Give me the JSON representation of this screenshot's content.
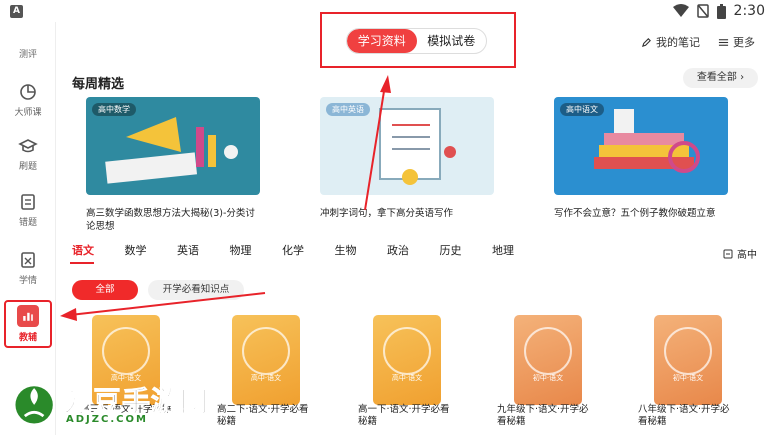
{
  "statusbar": {
    "app_badge": "A",
    "time": "2:30"
  },
  "sidebar": {
    "items": [
      {
        "label": "测评"
      },
      {
        "label": "大师课"
      },
      {
        "label": "刷题"
      },
      {
        "label": "错题"
      },
      {
        "label": "学情"
      },
      {
        "label": "教辅"
      }
    ]
  },
  "topbar": {
    "tabs": [
      {
        "label": "学习资料"
      },
      {
        "label": "模拟试卷"
      }
    ],
    "my_notes": "我的笔记",
    "more": "更多"
  },
  "weekly": {
    "title": "每周精选",
    "view_all": "查看全部 ›",
    "cards": [
      {
        "tag": "高中数学",
        "caption": "高三数学函数思想方法大揭秘(3)-分类讨论思想",
        "color": "#2f8aa0"
      },
      {
        "tag": "高中英语",
        "caption": "冲刺字词句，拿下高分英语写作",
        "color": "#dfeef4"
      },
      {
        "tag": "高中语文",
        "caption": "写作不会立意？五个例子教你破题立意",
        "color": "#2b8fd0"
      }
    ]
  },
  "subjects": {
    "items": [
      "语文",
      "数学",
      "英语",
      "物理",
      "化学",
      "生物",
      "政治",
      "历史",
      "地理"
    ],
    "selected": "语文",
    "grade": "高中"
  },
  "filters": {
    "all": "全部",
    "knowledge": "开学必看知识点"
  },
  "books": [
    {
      "label": "高中·语文",
      "title": "高三下·语文·开学秘籍"
    },
    {
      "label": "高中·语文",
      "title": "高二下·语文·开学必看秘籍"
    },
    {
      "label": "高中·语文",
      "title": "高一下·语文·开学必看秘籍"
    },
    {
      "label": "初中·语文",
      "title": "九年级下·语文·开学必看秘籍"
    },
    {
      "label": "初中·语文",
      "title": "八年级下·语文·开学必看秘籍"
    }
  ],
  "watermark": {
    "title": "爱豆手游网",
    "sub": "ADJZC.COM"
  }
}
